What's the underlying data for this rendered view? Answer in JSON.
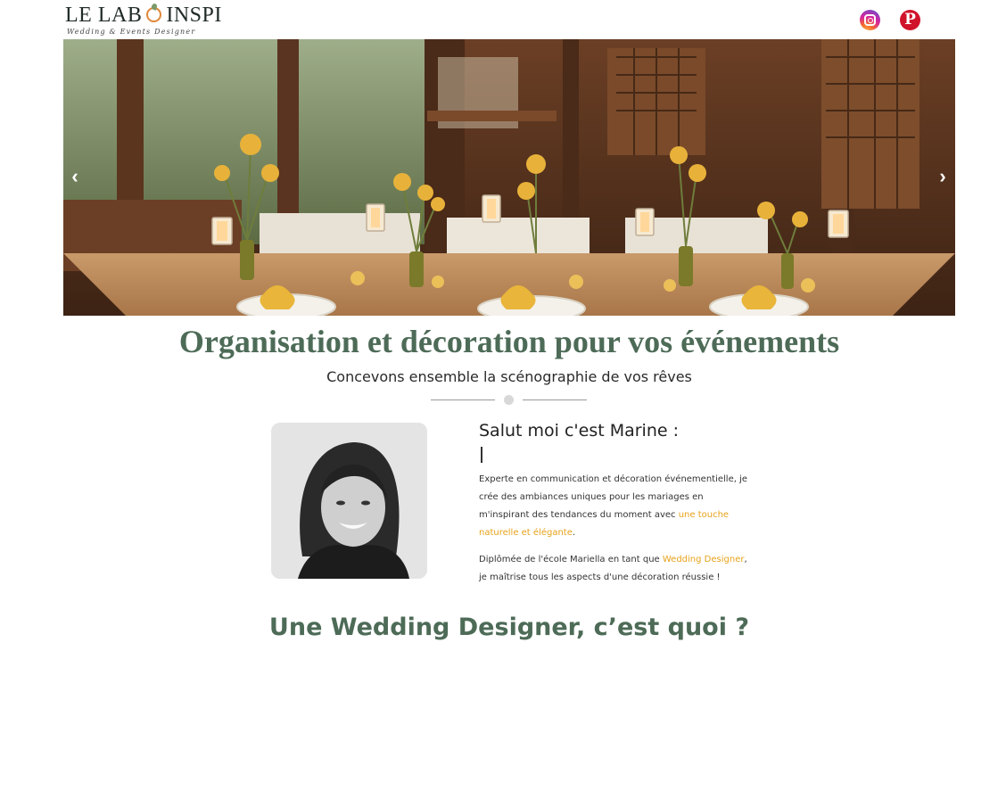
{
  "header": {
    "logo_main_left": "LE LAB",
    "logo_main_right": "INSPI",
    "logo_tagline": "Wedding & Events Designer",
    "social": [
      {
        "name": "instagram-icon"
      },
      {
        "name": "pinterest-icon",
        "glyph": "P"
      }
    ]
  },
  "hero": {
    "prev_glyph": "‹",
    "next_glyph": "›"
  },
  "main": {
    "title": "Organisation et décoration pour vos événements",
    "subtitle": "Concevons ensemble la scénographie de vos rêves"
  },
  "intro": {
    "heading": "Salut moi c'est Marine :",
    "p1_before": "Experte en communication et décoration événementielle, je crée des ambiances uniques pour les mariages en m'inspirant des tendances du moment avec ",
    "p1_highlight": "une touche naturelle et élégante",
    "p1_after": ".",
    "p2_before": "Diplômée de l'école Mariella en tant que ",
    "p2_highlight": "Wedding Designer",
    "p2_after": ", je maîtrise tous les aspects d'une décoration réussie !"
  },
  "section": {
    "title": "Une Wedding Designer, c’est quoi ?"
  },
  "colors": {
    "accent_green": "#4d6b57",
    "highlight_orange": "#e8a21a"
  }
}
